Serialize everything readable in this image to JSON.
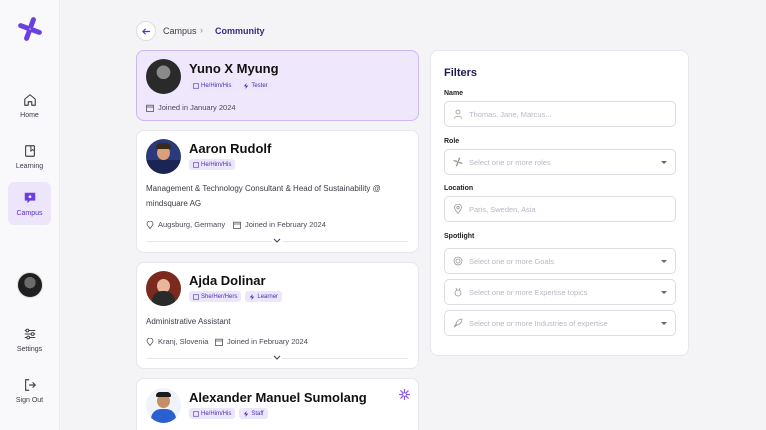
{
  "sidebar": {
    "items": [
      {
        "label": "Home",
        "icon": "home-icon"
      },
      {
        "label": "Learning",
        "icon": "book-icon"
      },
      {
        "label": "Campus",
        "icon": "chat-icon"
      },
      {
        "label": "Settings",
        "icon": "sliders-icon"
      },
      {
        "label": "Sign Out",
        "icon": "sign-out-icon"
      }
    ],
    "active": "Campus"
  },
  "breadcrumb": {
    "parent": "Campus",
    "separator": "›",
    "current": "Community"
  },
  "members": [
    {
      "name": "Yuno X Myung",
      "pronouns": "He/Him/His",
      "role": "Tester",
      "joined": "Joined in January 2024"
    },
    {
      "name": "Aaron Rudolf",
      "pronouns": "He/Him/His",
      "description": "Management & Technology Consultant & Head of Sustainability @ mindsquare AG",
      "location": "Augsburg, Germany",
      "joined": "Joined in February 2024"
    },
    {
      "name": "Ajda Dolinar",
      "pronouns": "She/Her/Hers",
      "role": "Learner",
      "description": "Administrative Assistant",
      "location": "Kranj, Slovenia",
      "joined": "Joined in February 2024"
    },
    {
      "name": "Alexander Manuel Sumolang",
      "pronouns": "He/Him/His",
      "role": "Staff"
    }
  ],
  "filters": {
    "title": "Filters",
    "name_label": "Name",
    "name_placeholder": "Thomas, Jane, Marcus...",
    "role_label": "Role",
    "role_placeholder": "Select one or more roles",
    "location_label": "Location",
    "location_placeholder": "Paris, Sweden, Asia",
    "spotlight_label": "Spotlight",
    "goals_placeholder": "Select one or more Goals",
    "expertise_placeholder": "Select one or more Expertise topics",
    "industries_placeholder": "Select one or more Industries of expertise"
  },
  "colors": {
    "accent": "#5b2fc9",
    "highlight": "#efe7fc",
    "badge_bg": "#ece6fb"
  }
}
